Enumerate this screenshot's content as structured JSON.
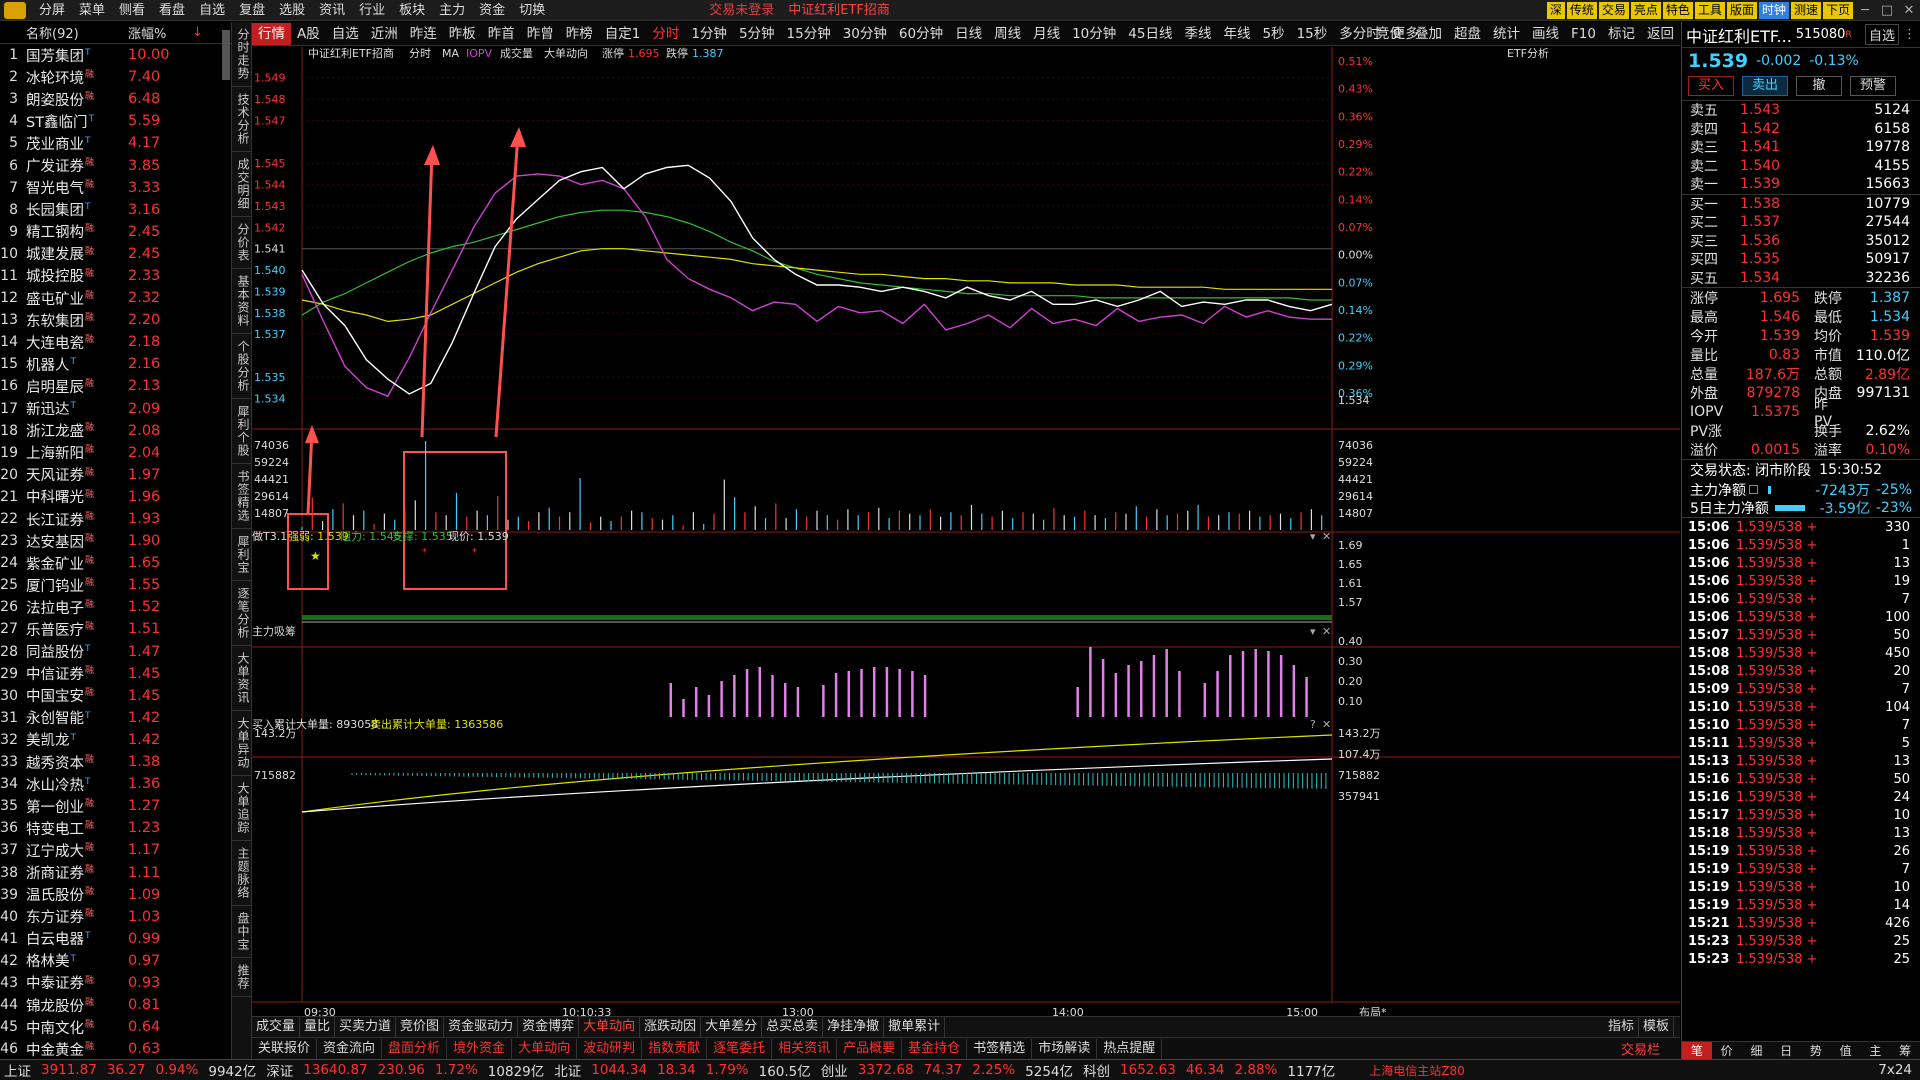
{
  "menu": {
    "items": [
      "分屏",
      "菜单",
      "侧看",
      "看盘",
      "自选",
      "复盘",
      "选股",
      "资讯",
      "行业",
      "板块",
      "主力",
      "资金",
      "切换"
    ],
    "trade_status": "交易未登录",
    "fund_name": "中证红利ETF招商",
    "tool_buttons": [
      "深",
      "传统",
      "交易",
      "亮点",
      "特色",
      "工具",
      "版面",
      "时钟",
      "测速",
      "下页"
    ]
  },
  "left": {
    "header_name": "名称(92)",
    "header_pct": "涨幅%",
    "rows": [
      {
        "no": "1",
        "name": "国芳集团",
        "tag": "T",
        "pct": "10.00"
      },
      {
        "no": "2",
        "name": "冰轮环境",
        "tag": "融",
        "pct": "7.40"
      },
      {
        "no": "3",
        "name": "朗姿股份",
        "tag": "融",
        "pct": "6.48"
      },
      {
        "no": "4",
        "name": "ST鑫临门",
        "tag": "T",
        "pct": "5.59"
      },
      {
        "no": "5",
        "name": "茂业商业",
        "tag": "T",
        "pct": "4.17"
      },
      {
        "no": "6",
        "name": "广发证券",
        "tag": "融",
        "pct": "3.85"
      },
      {
        "no": "7",
        "name": "智光电气",
        "tag": "融",
        "pct": "3.33"
      },
      {
        "no": "8",
        "name": "长园集团",
        "tag": "T",
        "pct": "3.16"
      },
      {
        "no": "9",
        "name": "精工钢构",
        "tag": "融",
        "pct": "2.45"
      },
      {
        "no": "10",
        "name": "城建发展",
        "tag": "融",
        "pct": "2.45"
      },
      {
        "no": "11",
        "name": "城投控股",
        "tag": "融",
        "pct": "2.33"
      },
      {
        "no": "12",
        "name": "盛屯矿业",
        "tag": "融",
        "pct": "2.32"
      },
      {
        "no": "13",
        "name": "东软集团",
        "tag": "融",
        "pct": "2.20"
      },
      {
        "no": "14",
        "name": "大连电瓷",
        "tag": "融",
        "pct": "2.18"
      },
      {
        "no": "15",
        "name": "机器人",
        "tag": "T",
        "pct": "2.16"
      },
      {
        "no": "16",
        "name": "启明星辰",
        "tag": "融",
        "pct": "2.13"
      },
      {
        "no": "17",
        "name": "新迅达",
        "tag": "T",
        "pct": "2.09"
      },
      {
        "no": "18",
        "name": "浙江龙盛",
        "tag": "融",
        "pct": "2.08"
      },
      {
        "no": "19",
        "name": "上海新阳",
        "tag": "融",
        "pct": "2.04"
      },
      {
        "no": "20",
        "name": "天风证券",
        "tag": "融",
        "pct": "1.97"
      },
      {
        "no": "21",
        "name": "中科曙光",
        "tag": "融",
        "pct": "1.96"
      },
      {
        "no": "22",
        "name": "长江证券",
        "tag": "融",
        "pct": "1.93"
      },
      {
        "no": "23",
        "name": "达安基因",
        "tag": "融",
        "pct": "1.90"
      },
      {
        "no": "24",
        "name": "紫金矿业",
        "tag": "融",
        "pct": "1.65"
      },
      {
        "no": "25",
        "name": "厦门钨业",
        "tag": "融",
        "pct": "1.55"
      },
      {
        "no": "26",
        "name": "法拉电子",
        "tag": "融",
        "pct": "1.52"
      },
      {
        "no": "27",
        "name": "乐普医疗",
        "tag": "融",
        "pct": "1.51"
      },
      {
        "no": "28",
        "name": "同益股份",
        "tag": "T",
        "pct": "1.47"
      },
      {
        "no": "29",
        "name": "中信证券",
        "tag": "融",
        "pct": "1.45"
      },
      {
        "no": "30",
        "name": "中国宝安",
        "tag": "融",
        "pct": "1.45"
      },
      {
        "no": "31",
        "name": "永创智能",
        "tag": "T",
        "pct": "1.42"
      },
      {
        "no": "32",
        "name": "美凯龙",
        "tag": "T",
        "pct": "1.42"
      },
      {
        "no": "33",
        "name": "越秀资本",
        "tag": "融",
        "pct": "1.38"
      },
      {
        "no": "34",
        "name": "冰山冷热",
        "tag": "T",
        "pct": "1.36"
      },
      {
        "no": "35",
        "name": "第一创业",
        "tag": "融",
        "pct": "1.27"
      },
      {
        "no": "36",
        "name": "特变电工",
        "tag": "融",
        "pct": "1.23"
      },
      {
        "no": "37",
        "name": "辽宁成大",
        "tag": "融",
        "pct": "1.17"
      },
      {
        "no": "38",
        "name": "浙商证券",
        "tag": "融",
        "pct": "1.11"
      },
      {
        "no": "39",
        "name": "温氏股份",
        "tag": "融",
        "pct": "1.09"
      },
      {
        "no": "40",
        "name": "东方证券",
        "tag": "融",
        "pct": "1.03"
      },
      {
        "no": "41",
        "name": "白云电器",
        "tag": "T",
        "pct": "0.99"
      },
      {
        "no": "42",
        "name": "格林美",
        "tag": "T",
        "pct": "0.97"
      },
      {
        "no": "43",
        "name": "中泰证券",
        "tag": "融",
        "pct": "0.93"
      },
      {
        "no": "44",
        "name": "锦龙股份",
        "tag": "融",
        "pct": "0.81"
      },
      {
        "no": "45",
        "name": "中南文化",
        "tag": "融",
        "pct": "0.64"
      },
      {
        "no": "46",
        "name": "中金黄金",
        "tag": "融",
        "pct": "0.63"
      }
    ]
  },
  "vtabs": [
    "分时走势",
    "技术分析",
    "成交明细",
    "分价表",
    "基本资料",
    "个股分析",
    "犀利个股",
    "书签精选",
    "犀利宝",
    "逐笔分析",
    "大单资讯",
    "大单异动",
    "大单追踪",
    "主题脉络",
    "盘中宝",
    "推荐"
  ],
  "tabs": [
    "行情",
    "A股",
    "自选",
    "近洲",
    "昨连",
    "昨板",
    "昨首",
    "昨曾",
    "昨榜",
    "自定1",
    "分时",
    "1分钟",
    "5分钟",
    "15分钟",
    "30分钟",
    "60分钟",
    "日线",
    "周线",
    "月线",
    "10分钟",
    "45日线",
    "季线",
    "年线",
    "5秒",
    "15秒",
    "多分时",
    "更多"
  ],
  "tabs_right": [
    "竞价",
    "叠加",
    "超盘",
    "统计",
    "画线",
    "F10",
    "标记",
    "返回"
  ],
  "chart": {
    "title": "中证红利ETF招商",
    "mode": "分时",
    "ma": "MA",
    "iopv": "IOPV",
    "vol": "成交量",
    "big": "大单动向",
    "zt_label": "涨停",
    "zt": "1.695",
    "dt_label": "跌停",
    "dt": "1.387",
    "etf": "ETF分析",
    "price_ticks": [
      "1.549",
      "1.548",
      "1.547",
      "1.545",
      "1.544",
      "1.543",
      "1.542",
      "1.541",
      "1.540",
      "1.539",
      "1.538",
      "1.537",
      "1.535",
      "1.534"
    ],
    "pct_ticks": [
      "0.51%",
      "0.43%",
      "0.36%",
      "0.29%",
      "0.22%",
      "0.14%",
      "0.07%",
      "0.00%",
      "0.07%",
      "0.14%",
      "0.22%",
      "0.29%",
      "0.36%"
    ],
    "right_last": "1.534",
    "vol_ticks": [
      "74036",
      "59224",
      "44421",
      "29614",
      "14807"
    ],
    "ind1": {
      "name": "做T3.1",
      "weak": "强弱: 1.539",
      "res": "阻力: 1.545",
      "sup": "支撑: 1.535",
      "cur": "现价: 1.539",
      "ticks": [
        "1.69",
        "1.65",
        "1.61",
        "1.57"
      ]
    },
    "ind2": {
      "name": "主力吸筹",
      "ticks": [
        "0.40",
        "0.30",
        "0.20",
        "0.10"
      ]
    },
    "ind3": {
      "buy": "买入累计大单量: 893058",
      "sell": "卖出累计大单量: 1363586",
      "ticks": [
        "143.2万",
        "107.4万",
        "715882",
        "357941"
      ]
    },
    "time_ticks": [
      "09:30",
      "10:10:33",
      "13:00",
      "14:00",
      "15:00"
    ],
    "layout_btn": "布局*",
    "price_line": [
      1.54,
      1.5384,
      1.5374,
      1.5358,
      1.5349,
      1.5342,
      1.5347,
      1.5366,
      1.5389,
      1.5411,
      1.5424,
      1.5433,
      1.5442,
      1.5446,
      1.5448,
      1.5438,
      1.5445,
      1.5448,
      1.5449,
      1.5443,
      1.5432,
      1.5415,
      1.5405,
      1.5398,
      1.5393,
      1.5393,
      1.5392,
      1.539,
      1.5392,
      1.539,
      1.5387,
      1.5392,
      1.5388,
      1.5386,
      1.539,
      1.5384,
      1.5384,
      1.5386,
      1.5383,
      1.5386,
      1.539,
      1.5383,
      1.5385,
      1.5384,
      1.5386,
      1.5386,
      1.5383,
      1.5381,
      1.5384
    ],
    "iopv_line": [
      1.5398,
      1.5376,
      1.5355,
      1.5345,
      1.5341,
      1.5359,
      1.538,
      1.54,
      1.542,
      1.5436,
      1.5444,
      1.5445,
      1.5444,
      1.544,
      1.5442,
      1.5438,
      1.5425,
      1.5405,
      1.5396,
      1.5391,
      1.5387,
      1.5381,
      1.5385,
      1.5384,
      1.5376,
      1.5383,
      1.538,
      1.5381,
      1.5375,
      1.5384,
      1.5372,
      1.5375,
      1.5379,
      1.5373,
      1.5382,
      1.5375,
      1.5377,
      1.5374,
      1.5382,
      1.5376,
      1.5378,
      1.5379,
      1.5375,
      1.5383,
      1.5378,
      1.5381,
      1.5378,
      1.5377,
      1.5377
    ],
    "avg_line": [
      1.5386,
      1.5384,
      1.5381,
      1.5379,
      1.5376,
      1.5377,
      1.5379,
      1.5384,
      1.5389,
      1.5394,
      1.5399,
      1.5403,
      1.5406,
      1.5409,
      1.541,
      1.541,
      1.5409,
      1.5408,
      1.5407,
      1.5406,
      1.5405,
      1.5403,
      1.5402,
      1.5401,
      1.54,
      1.5399,
      1.5398,
      1.5398,
      1.5397,
      1.5396,
      1.5396,
      1.5395,
      1.5395,
      1.5394,
      1.5394,
      1.5394,
      1.5393,
      1.5393,
      1.5393,
      1.5392,
      1.5392,
      1.5392,
      1.5392,
      1.5391,
      1.5391,
      1.5391,
      1.5391,
      1.5391,
      1.5391
    ],
    "ma_line": [
      1.5379,
      1.5385,
      1.5389,
      1.5394,
      1.5399,
      1.5404,
      1.5408,
      1.5411,
      1.5413,
      1.5416,
      1.5419,
      1.5422,
      1.5425,
      1.5427,
      1.5428,
      1.5428,
      1.5427,
      1.5425,
      1.5422,
      1.5418,
      1.5413,
      1.5409,
      1.5404,
      1.5401,
      1.5398,
      1.5396,
      1.5394,
      1.5393,
      1.5392,
      1.5391,
      1.539,
      1.5389,
      1.5389,
      1.5388,
      1.5388,
      1.5388,
      1.5388,
      1.5387,
      1.5387,
      1.5387,
      1.5387,
      1.5387,
      1.5387,
      1.5387,
      1.5387,
      1.5387,
      1.5387,
      1.5386,
      1.5386
    ],
    "volumes": [
      2,
      22,
      6,
      14,
      18,
      10,
      13,
      4,
      11,
      7,
      14,
      20,
      60,
      12,
      10,
      25,
      9,
      13,
      10,
      23,
      7,
      9,
      6,
      12,
      15,
      9,
      12,
      35,
      5,
      9,
      6,
      9,
      13,
      12,
      8,
      7,
      10,
      3,
      12,
      4,
      11,
      34,
      22,
      12,
      16,
      8,
      18,
      8,
      14,
      9,
      13,
      10,
      7,
      14,
      10,
      12,
      15,
      8,
      13,
      11,
      10,
      14,
      9,
      12,
      10,
      17,
      11,
      9,
      13,
      8,
      12,
      11,
      7,
      15,
      10,
      9,
      13,
      10,
      8,
      12,
      11,
      16,
      9,
      14,
      10,
      11,
      13,
      17,
      9,
      10,
      12,
      11,
      13,
      9,
      10,
      11,
      8,
      12,
      14,
      10
    ],
    "xichou": [
      0,
      0,
      0,
      0,
      0,
      0,
      0,
      0,
      0,
      0,
      0,
      0,
      0,
      0,
      0,
      0,
      0,
      0,
      0,
      0,
      0,
      0,
      0,
      0,
      0,
      0,
      0,
      0,
      0,
      0.17,
      0.09,
      0.15,
      0.11,
      0.18,
      0.21,
      0.24,
      0.25,
      0.21,
      0.17,
      0.15,
      0,
      0.16,
      0.22,
      0.23,
      0.24,
      0.25,
      0.25,
      0.24,
      0.23,
      0.21,
      0,
      0,
      0,
      0,
      0,
      0,
      0,
      0,
      0,
      0,
      0,
      0.15,
      0.35,
      0.29,
      0.22,
      0.26,
      0.28,
      0.31,
      0.34,
      0.23,
      0,
      0.17,
      0.23,
      0.31,
      0.33,
      0.34,
      0.33,
      0.31,
      0.26,
      0.2,
      0
    ]
  },
  "quote": {
    "title": "中证红利ETF...",
    "code": "515080",
    "add": "自选",
    "price": "1.539",
    "chg": "-0.002",
    "chg_pct": "-0.13%",
    "buy": "买入",
    "sell": "卖出",
    "cancel": "撤",
    "alert": "预警",
    "asks": [
      {
        "l": "卖五",
        "p": "1.543",
        "v": "5124"
      },
      {
        "l": "卖四",
        "p": "1.542",
        "v": "6158"
      },
      {
        "l": "卖三",
        "p": "1.541",
        "v": "19778"
      },
      {
        "l": "卖二",
        "p": "1.540",
        "v": "4155"
      },
      {
        "l": "卖一",
        "p": "1.539",
        "v": "15663"
      }
    ],
    "bids": [
      {
        "l": "买一",
        "p": "1.538",
        "v": "10779"
      },
      {
        "l": "买二",
        "p": "1.537",
        "v": "27544"
      },
      {
        "l": "买三",
        "p": "1.536",
        "v": "35012"
      },
      {
        "l": "买四",
        "p": "1.535",
        "v": "50917"
      },
      {
        "l": "买五",
        "p": "1.534",
        "v": "32236"
      }
    ],
    "info": [
      {
        "k": "涨停",
        "v": "1.695",
        "k2": "跌停",
        "v2": "1.387",
        "c2": "#40d0ff"
      },
      {
        "k": "最高",
        "v": "1.546",
        "k2": "最低",
        "v2": "1.534",
        "c2": "#40d0ff"
      },
      {
        "k": "今开",
        "v": "1.539",
        "k2": "均价",
        "v2": "1.539",
        "c2": "#ff3030"
      },
      {
        "k": "量比",
        "v": "0.83",
        "k2": "市值",
        "v2": "110.0亿",
        "c2": "#fff"
      },
      {
        "k": "总量",
        "v": "187.6万",
        "k2": "总额",
        "v2": "2.89亿",
        "c2": "#ff3030"
      },
      {
        "k": "外盘",
        "v": "879278",
        "k2": "内盘",
        "v2": "997131",
        "c2": "#fff"
      },
      {
        "k": "IOPV",
        "v": "1.5375",
        "k2": "昨PV",
        "v2": "",
        "c2": "#fff"
      },
      {
        "k": "PV涨",
        "v": "",
        "k2": "换手",
        "v2": "2.62%",
        "c2": "#fff"
      },
      {
        "k": "溢价",
        "v": "0.0015",
        "k2": "溢率",
        "v2": "0.10%",
        "c2": "#ff3030"
      }
    ],
    "status_label": "交易状态: 闭市阶段",
    "status_time": "15:30:52",
    "net1_label": "主力净额",
    "net1_val": "-7243万",
    "net1_pct": "-25%",
    "net5_label": "5日主力净额",
    "net5_val": "-3.59亿",
    "net5_pct": "-23%",
    "ticks": [
      {
        "t": "15:06",
        "p": "1.539/538 +",
        "v": "330"
      },
      {
        "t": "15:06",
        "p": "1.539/538 +",
        "v": "1"
      },
      {
        "t": "15:06",
        "p": "1.539/538 +",
        "v": "13"
      },
      {
        "t": "15:06",
        "p": "1.539/538 +",
        "v": "19"
      },
      {
        "t": "15:06",
        "p": "1.539/538 +",
        "v": "7"
      },
      {
        "t": "15:06",
        "p": "1.539/538 +",
        "v": "100"
      },
      {
        "t": "15:07",
        "p": "1.539/538 +",
        "v": "50"
      },
      {
        "t": "15:08",
        "p": "1.539/538 +",
        "v": "450"
      },
      {
        "t": "15:08",
        "p": "1.539/538 +",
        "v": "20"
      },
      {
        "t": "15:09",
        "p": "1.539/538 +",
        "v": "7"
      },
      {
        "t": "15:10",
        "p": "1.539/538 +",
        "v": "104"
      },
      {
        "t": "15:10",
        "p": "1.539/538 +",
        "v": "7"
      },
      {
        "t": "15:11",
        "p": "1.539/538 +",
        "v": "5"
      },
      {
        "t": "15:13",
        "p": "1.539/538 +",
        "v": "13"
      },
      {
        "t": "15:16",
        "p": "1.539/538 +",
        "v": "50"
      },
      {
        "t": "15:16",
        "p": "1.539/538 +",
        "v": "24"
      },
      {
        "t": "15:17",
        "p": "1.539/538 +",
        "v": "10"
      },
      {
        "t": "15:18",
        "p": "1.539/538 +",
        "v": "13"
      },
      {
        "t": "15:19",
        "p": "1.539/538 +",
        "v": "26"
      },
      {
        "t": "15:19",
        "p": "1.539/538 +",
        "v": "7"
      },
      {
        "t": "15:19",
        "p": "1.539/538 +",
        "v": "10"
      },
      {
        "t": "15:19",
        "p": "1.539/538 +",
        "v": "14"
      },
      {
        "t": "15:21",
        "p": "1.539/538 +",
        "v": "426"
      },
      {
        "t": "15:23",
        "p": "1.539/538 +",
        "v": "25"
      },
      {
        "t": "15:23",
        "p": "1.539/538 +",
        "v": "25"
      }
    ],
    "footer_tabs": [
      "笔",
      "价",
      "细",
      "日",
      "势",
      "值",
      "主",
      "筹"
    ]
  },
  "bottom_tabs": [
    "成交量",
    "量比",
    "买卖力道",
    "竞价图",
    "资金驱动力",
    "资金博弈",
    "大单动向",
    "涨跌动因",
    "大单差分",
    "总买总卖",
    "净挂净撤",
    "撤单累计"
  ],
  "bottom_right": [
    "指标",
    "模板"
  ],
  "bottom_tabs2": [
    "关联报价",
    "资金流向",
    "盘面分析",
    "境外资金",
    "大单动向",
    "波动研判",
    "指数贡献",
    "逐笔委托",
    "相关资讯",
    "产品概要",
    "基金持仓",
    "书签精选",
    "市场解读",
    "热点提醒"
  ],
  "bottom_tabs2_right": "交易栏",
  "status": {
    "sh_label": "上证",
    "sh": "3911.87",
    "sh_chg": "36.27",
    "sh_pct": "0.94%",
    "sh_amt": "9942亿",
    "sz_label": "深证",
    "sz": "13640.87",
    "sz_chg": "230.96",
    "sz_pct": "1.72%",
    "sz_amt": "10829亿",
    "bz_label": "北证",
    "bz": "1044.34",
    "bz_chg": "18.34",
    "bz_pct": "1.79%",
    "bz_amt": "160.5亿",
    "cy_label": "创业",
    "cy": "3372.68",
    "cy_chg": "74.37",
    "cy_pct": "2.25%",
    "cy_amt": "5254亿",
    "kc_label": "科创",
    "kc": "1652.63",
    "kc_chg": "46.34",
    "kc_pct": "2.88%",
    "kc_amt": "1177亿",
    "server": "上海电信主站Z80",
    "right": "7x24"
  }
}
